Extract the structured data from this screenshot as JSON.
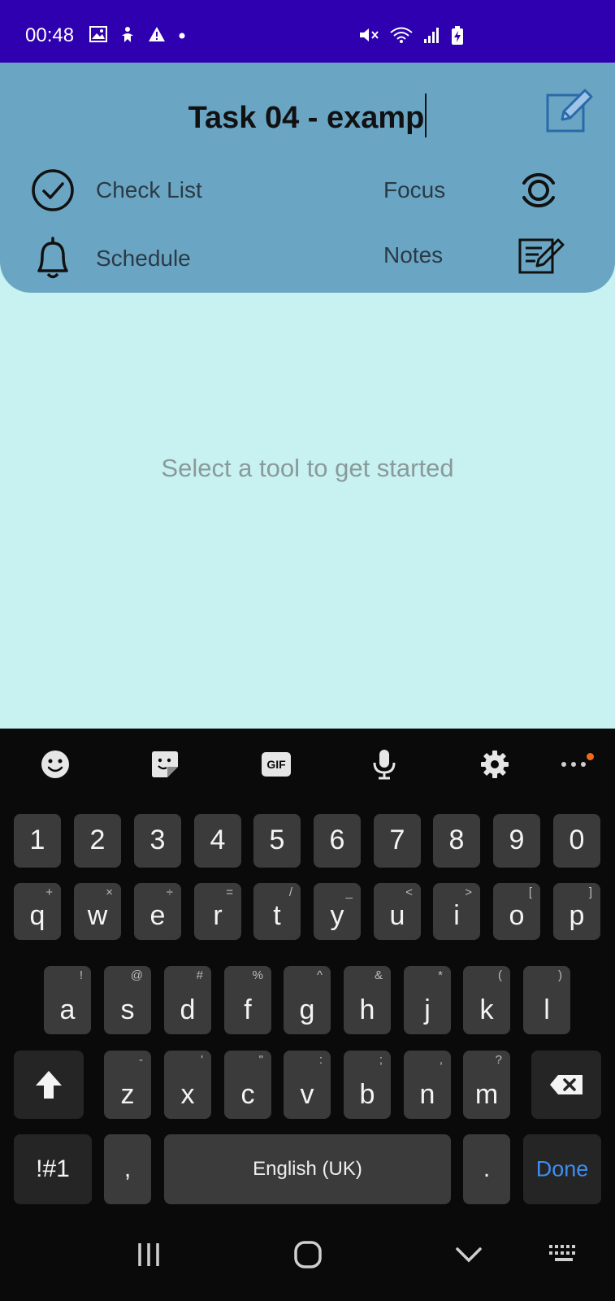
{
  "status_bar": {
    "time": "00:48",
    "left_icons": [
      "image-icon",
      "accessibility-icon",
      "warning-icon",
      "dot-icon"
    ],
    "right_icons": [
      "mute-icon",
      "wifi-icon",
      "signal-icon",
      "battery-charging-icon"
    ],
    "background": "#2f00b0"
  },
  "header": {
    "title_value": "Task 04 - examp",
    "background": "#6aa6c4",
    "tools": {
      "checklist": "Check List",
      "focus": "Focus",
      "schedule": "Schedule",
      "notes": "Notes"
    }
  },
  "main": {
    "empty_hint": "Select a tool to get started",
    "background": "#c8f1f1"
  },
  "keyboard": {
    "toolbar_icons": [
      "emoji-icon",
      "sticker-icon",
      "gif-icon",
      "microphone-icon",
      "settings-icon",
      "more-icon"
    ],
    "gif_label": "GIF",
    "number_row": [
      "1",
      "2",
      "3",
      "4",
      "5",
      "6",
      "7",
      "8",
      "9",
      "0"
    ],
    "row1": [
      {
        "main": "q",
        "sub": "+"
      },
      {
        "main": "w",
        "sub": "×"
      },
      {
        "main": "e",
        "sub": "÷"
      },
      {
        "main": "r",
        "sub": "="
      },
      {
        "main": "t",
        "sub": "/"
      },
      {
        "main": "y",
        "sub": "_"
      },
      {
        "main": "u",
        "sub": "<"
      },
      {
        "main": "i",
        "sub": ">"
      },
      {
        "main": "o",
        "sub": "["
      },
      {
        "main": "p",
        "sub": "]"
      }
    ],
    "row2": [
      {
        "main": "a",
        "sub": "!"
      },
      {
        "main": "s",
        "sub": "@"
      },
      {
        "main": "d",
        "sub": "#"
      },
      {
        "main": "f",
        "sub": "%"
      },
      {
        "main": "g",
        "sub": "^"
      },
      {
        "main": "h",
        "sub": "&"
      },
      {
        "main": "j",
        "sub": "*"
      },
      {
        "main": "k",
        "sub": "("
      },
      {
        "main": "l",
        "sub": ")"
      }
    ],
    "row3": [
      {
        "main": "z",
        "sub": "-"
      },
      {
        "main": "x",
        "sub": "'"
      },
      {
        "main": "c",
        "sub": "\""
      },
      {
        "main": "v",
        "sub": ":"
      },
      {
        "main": "b",
        "sub": ";"
      },
      {
        "main": "n",
        "sub": ","
      },
      {
        "main": "m",
        "sub": "?"
      }
    ],
    "symbols_label": "!#1",
    "comma_label": ",",
    "space_label": "English (UK)",
    "period_label": ".",
    "done_label": "Done",
    "accent_color": "#3d8ef0"
  },
  "navbar": {
    "icons": [
      "recent-apps-icon",
      "home-icon",
      "back-icon",
      "keyboard-icon"
    ]
  }
}
